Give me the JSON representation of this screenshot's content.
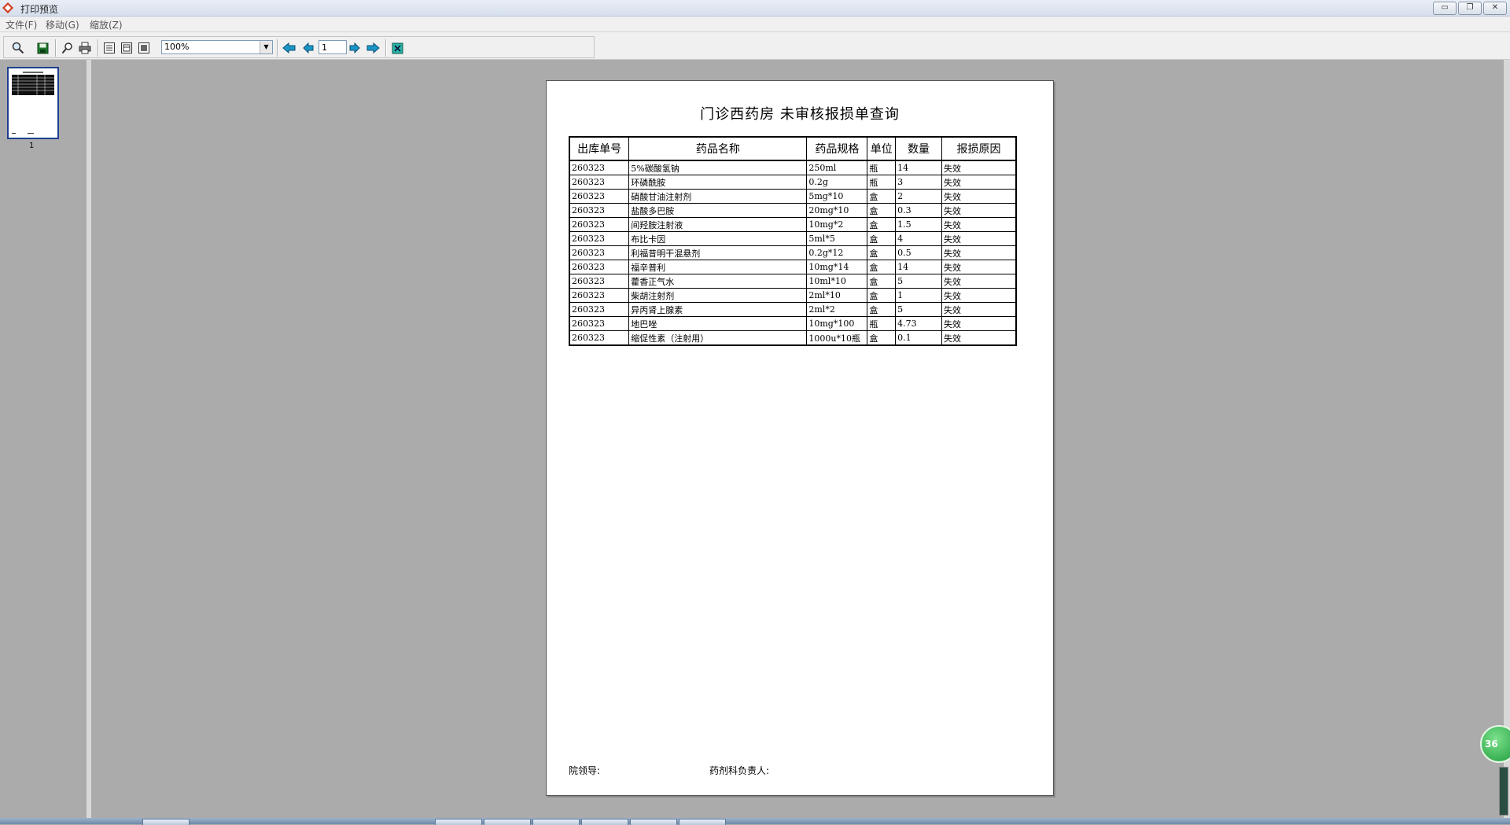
{
  "window": {
    "title": "打印预览",
    "minimize_label": "▭",
    "restore_label": "❐",
    "close_label": "✕"
  },
  "menu": {
    "items": [
      "文件(F)",
      "移动(G)",
      "缩放(Z)"
    ]
  },
  "toolbar": {
    "buttons": [
      "zoom-icon",
      "save-icon",
      "find-icon",
      "print-icon",
      "one-page-icon",
      "page-setup-icon",
      "multi-page-icon",
      "first-page-icon",
      "previous-page-icon",
      "next-page-icon",
      "last-page-icon",
      "exit-icon"
    ],
    "zoom_value": "100%",
    "page_value": "1"
  },
  "thumbnails": {
    "page_label": "1"
  },
  "report": {
    "title": "门诊西药房 未审核报损单查询",
    "headers": [
      "出库单号",
      "药品名称",
      "药品规格",
      "单位",
      "数量",
      "报损原因"
    ],
    "rows": [
      [
        "260323",
        "5%碳酸氢钠",
        "250ml",
        "瓶",
        "14",
        "失效"
      ],
      [
        "260323",
        "环磷酰胺",
        "0.2g",
        "瓶",
        "3",
        "失效"
      ],
      [
        "260323",
        "硝酸甘油注射剂",
        "5mg*10",
        "盒",
        "2",
        "失效"
      ],
      [
        "260323",
        "盐酸多巴胺",
        "20mg*10",
        "盒",
        "0.3",
        "失效"
      ],
      [
        "260323",
        "间羟胺注射液",
        "10mg*2",
        "盒",
        "1.5",
        "失效"
      ],
      [
        "260323",
        "布比卡因",
        "5ml*5",
        "盒",
        "4",
        "失效"
      ],
      [
        "260323",
        "利福昔明干混悬剂",
        "0.2g*12",
        "盒",
        "0.5",
        "失效"
      ],
      [
        "260323",
        "福辛普利",
        "10mg*14",
        "盒",
        "14",
        "失效"
      ],
      [
        "260323",
        "藿香正气水",
        "10ml*10",
        "盒",
        "5",
        "失效"
      ],
      [
        "260323",
        "柴胡注射剂",
        "2ml*10",
        "盒",
        "1",
        "失效"
      ],
      [
        "260323",
        "异丙肾上腺素",
        "2ml*2",
        "盒",
        "5",
        "失效"
      ],
      [
        "260323",
        "地巴唑",
        "10mg*100",
        "瓶",
        "4.73",
        "失效"
      ],
      [
        "260323",
        "缩促性素（注射用）",
        "1000u*10瓶",
        "盒",
        "0.1",
        "失效"
      ]
    ],
    "sign_left": "院领导:",
    "sign_right": "药剂科负责人:"
  },
  "side": {
    "badge_text": "36"
  }
}
